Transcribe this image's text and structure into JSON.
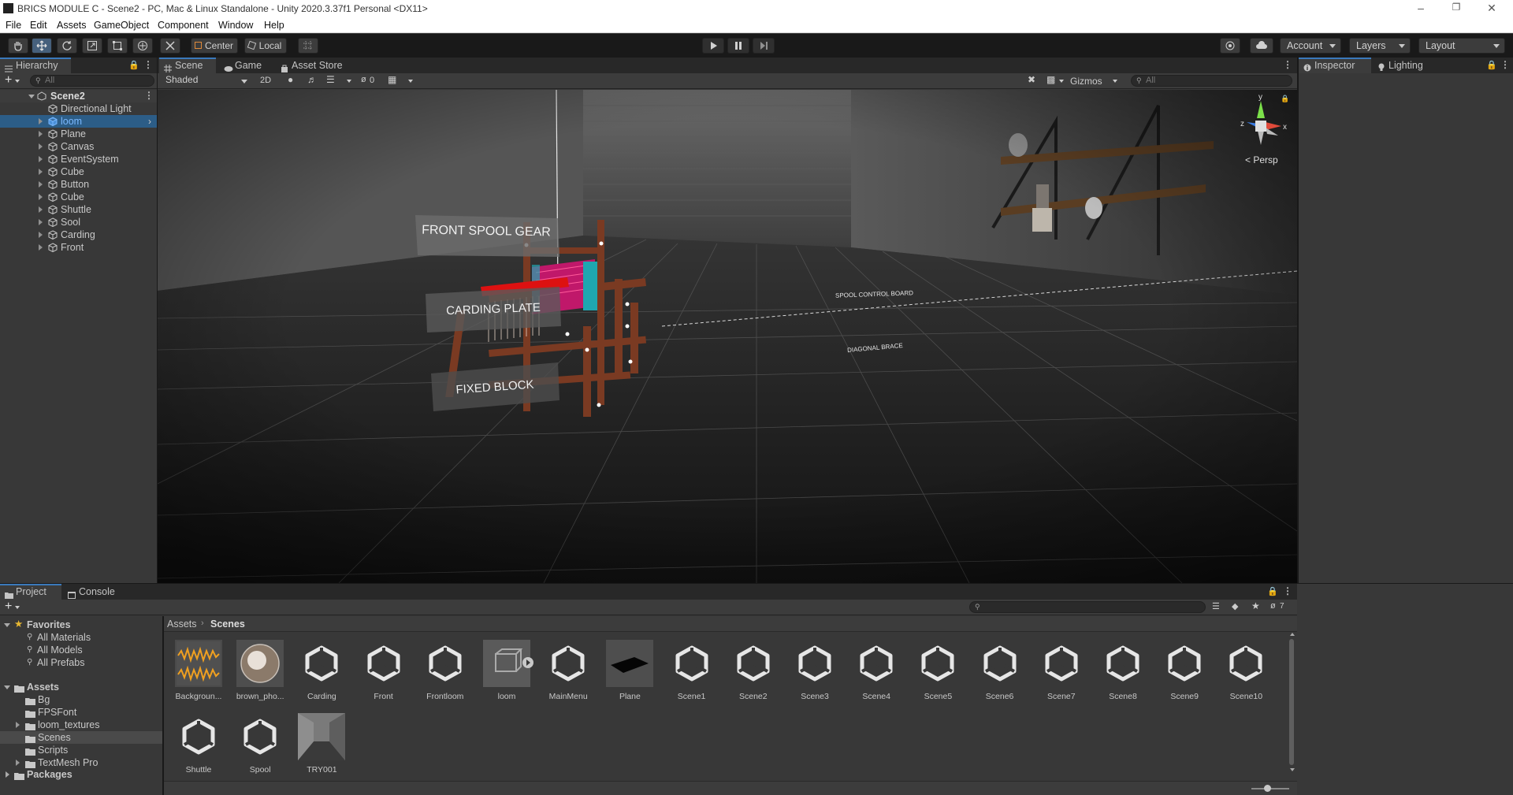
{
  "window": {
    "title": "BRICS MODULE C - Scene2 - PC, Mac & Linux Standalone - Unity 2020.3.37f1 Personal <DX11>"
  },
  "menu": [
    "File",
    "Edit",
    "Assets",
    "GameObject",
    "Component",
    "Window",
    "Help"
  ],
  "toolbar": {
    "pivot_label": "Center",
    "space_label": "Local",
    "account_label": "Account",
    "layers_label": "Layers",
    "layout_label": "Layout"
  },
  "hierarchy": {
    "tab_label": "Hierarchy",
    "search_placeholder": "All",
    "scene_name": "Scene2",
    "items": [
      "Directional Light",
      "loom",
      "Plane",
      "Canvas",
      "EventSystem",
      "Cube",
      "Button",
      "Cube",
      "Shuttle",
      "Sool",
      "Carding",
      "Front"
    ],
    "selected_index": 1
  },
  "scene": {
    "tabs": [
      "Scene",
      "Game",
      "Asset Store"
    ],
    "shading_mode": "Shaded",
    "mode_2d": "2D",
    "hidden_count": "0",
    "gizmos_label": "Gizmos",
    "search_placeholder": "All",
    "projection_label": "< Persp",
    "axis_labels": {
      "y": "y",
      "x": "x",
      "z": "z"
    },
    "world_labels": [
      "FRONT SPOOL GEAR",
      "CARDING PLATE",
      "FIXED BLOCK",
      "SPOOL CONTROL BOARD",
      "DIAGONAL BRACE"
    ]
  },
  "inspector": {
    "tabs": [
      "Inspector",
      "Lighting"
    ]
  },
  "project": {
    "tabs": [
      "Project",
      "Console"
    ],
    "favorites_label": "Favorites",
    "favorites": [
      "All Materials",
      "All Models",
      "All Prefabs"
    ],
    "assets_label": "Assets",
    "folders": [
      "Bg",
      "FPSFont",
      "loom_textures",
      "Scenes",
      "Scripts",
      "TextMesh Pro"
    ],
    "selected_folder": "Scenes",
    "packages_label": "Packages",
    "breadcrumb": [
      "Assets",
      "Scenes"
    ],
    "hidden_count": "7",
    "assets": [
      {
        "name": "Backgroun...",
        "kind": "audio"
      },
      {
        "name": "brown_pho...",
        "kind": "sphere"
      },
      {
        "name": "Carding",
        "kind": "unity"
      },
      {
        "name": "Front",
        "kind": "unity"
      },
      {
        "name": "Frontloom",
        "kind": "unity"
      },
      {
        "name": "loom",
        "kind": "model"
      },
      {
        "name": "MainMenu",
        "kind": "unity"
      },
      {
        "name": "Plane",
        "kind": "plane"
      },
      {
        "name": "Scene1",
        "kind": "unity"
      },
      {
        "name": "Scene2",
        "kind": "unity"
      },
      {
        "name": "Scene3",
        "kind": "unity"
      },
      {
        "name": "Scene4",
        "kind": "unity"
      },
      {
        "name": "Scene5",
        "kind": "unity"
      },
      {
        "name": "Scene6",
        "kind": "unity"
      },
      {
        "name": "Scene7",
        "kind": "unity"
      },
      {
        "name": "Scene8",
        "kind": "unity"
      },
      {
        "name": "Scene9",
        "kind": "unity"
      },
      {
        "name": "Scene10",
        "kind": "unity"
      },
      {
        "name": "Shuttle",
        "kind": "unity"
      },
      {
        "name": "Spool",
        "kind": "unity"
      },
      {
        "name": "TRY001",
        "kind": "room"
      }
    ]
  },
  "colors": {
    "accent": "#3a79bb",
    "selection": "#2c5d87",
    "loom_wood": "#7a3a22",
    "loom_fabric": "#c0186a",
    "loom_teal": "#1fa6b0"
  }
}
